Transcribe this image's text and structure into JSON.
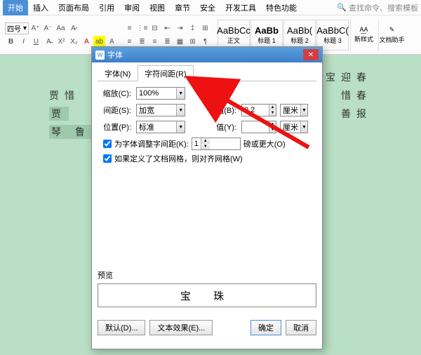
{
  "menubar": {
    "tabs": [
      "开始",
      "插入",
      "页面布局",
      "引用",
      "审阅",
      "视图",
      "章节",
      "安全",
      "开发工具",
      "特色功能"
    ],
    "search_placeholder": "查找命令、搜索模板"
  },
  "ribbon": {
    "fontsize": "四号",
    "gallery": [
      {
        "sample": "AaBbCc",
        "name": "正文"
      },
      {
        "sample": "AaBb",
        "name": "标题 1",
        "bold": true
      },
      {
        "sample": "AaBb(",
        "name": "标题 2"
      },
      {
        "sample": "AaBbC(",
        "name": "标题 3"
      }
    ],
    "newstyle": "新样式",
    "assistant": "文档助手"
  },
  "doc": {
    "line1_tail": "迎春",
    "line2_head": "贾惜",
    "line2_tail": "惜春",
    "line3": "贾",
    "line3_tail": "善报",
    "line4": "琴  鲁"
  },
  "dialog": {
    "title": "字体",
    "tab_font": "字体(N)",
    "tab_spacing": "字符间距(R)",
    "scale_label": "缩放(C):",
    "scale_value": "100%",
    "spacing_label": "间距(S):",
    "spacing_value": "加宽",
    "valb_label": "值(B):",
    "valb_value": "0.2",
    "unit": "厘米",
    "position_label": "位置(P):",
    "position_value": "标准",
    "valy_label": "值(Y):",
    "valy_value": "",
    "chk1": "为字体调整字间距(K):",
    "chk1_val": "1",
    "chk1_suffix": "磅或更大(O)",
    "chk2": "如果定义了文档网格，则对齐网格(W)",
    "preview_label": "预览",
    "preview_text": "宝 珠",
    "btn_default": "默认(D)...",
    "btn_effects": "文本效果(E)...",
    "btn_ok": "确定",
    "btn_cancel": "取消"
  }
}
